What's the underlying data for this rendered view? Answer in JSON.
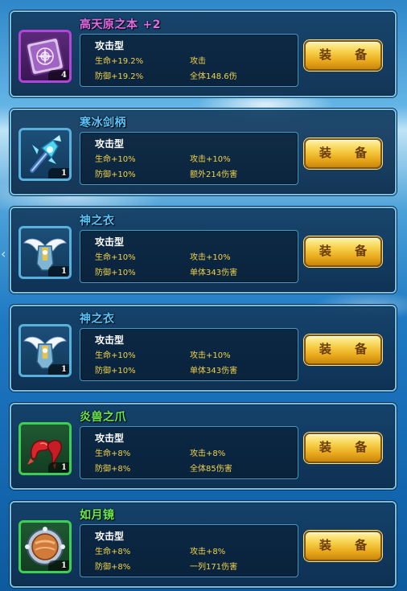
{
  "equipment_list": {
    "button_label": "装 备",
    "items": [
      {
        "name": "高天原之本",
        "enhance": "+2",
        "name_color": "#e46be8",
        "rarity": "purple",
        "icon": "book-icon",
        "count": "4",
        "type": "攻击型",
        "stat_hp": "生命+19.2%",
        "stat_effect1": "攻击",
        "stat_def": "防御+19.2%",
        "stat_effect2": "全体148.6伤"
      },
      {
        "name": "寒冰剑柄",
        "enhance": "",
        "name_color": "#59c6ff",
        "rarity": "blue",
        "icon": "ice-sword-hilt-icon",
        "count": "1",
        "type": "攻击型",
        "stat_hp": "生命+10%",
        "stat_effect1": "攻击+10%",
        "stat_def": "防御+10%",
        "stat_effect2": "额外214伤害"
      },
      {
        "name": "神之衣",
        "enhance": "",
        "name_color": "#59c6ff",
        "rarity": "blue",
        "icon": "winged-armor-icon",
        "count": "1",
        "type": "攻击型",
        "stat_hp": "生命+10%",
        "stat_effect1": "攻击+10%",
        "stat_def": "防御+10%",
        "stat_effect2": "单体343伤害"
      },
      {
        "name": "神之衣",
        "enhance": "",
        "name_color": "#59c6ff",
        "rarity": "blue",
        "icon": "winged-armor-icon",
        "count": "1",
        "type": "攻击型",
        "stat_hp": "生命+10%",
        "stat_effect1": "攻击+10%",
        "stat_def": "防御+10%",
        "stat_effect2": "单体343伤害"
      },
      {
        "name": "炎兽之爪",
        "enhance": "",
        "name_color": "#6bea4f",
        "rarity": "green",
        "icon": "claw-icon",
        "count": "1",
        "type": "攻击型",
        "stat_hp": "生命+8%",
        "stat_effect1": "攻击+8%",
        "stat_def": "防御+8%",
        "stat_effect2": "全体85伤害"
      },
      {
        "name": "如月镜",
        "enhance": "",
        "name_color": "#6bea4f",
        "rarity": "green",
        "icon": "mirror-icon",
        "count": "1",
        "type": "攻击型",
        "stat_hp": "生命+8%",
        "stat_effect1": "攻击+8%",
        "stat_def": "防御+8%",
        "stat_effect2": "一列171伤害"
      }
    ]
  },
  "colors": {
    "stat_text": "#f2d24a",
    "card_border": "#6ec2e8",
    "button_gold": "#f7d24e"
  }
}
